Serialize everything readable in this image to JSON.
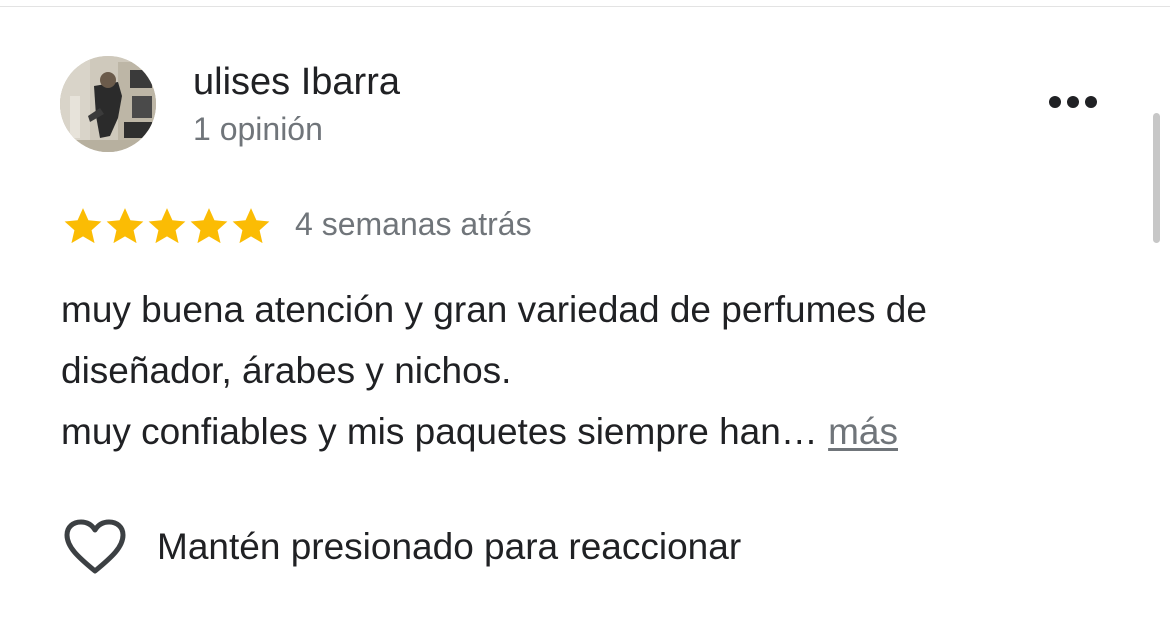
{
  "review": {
    "author": {
      "name": "ulises Ibarra",
      "meta": "1 opinión",
      "avatar_icon": "profile-photo"
    },
    "menu_icon": "more-horizontal-icon",
    "rating": {
      "value": 5,
      "max": 5,
      "star_color": "#FBBC04"
    },
    "time": "4 semanas atrás",
    "text_lines": [
      "muy buena atención y gran variedad de perfumes de",
      "diseñador, árabes y nichos.",
      "muy confiables y mis paquetes siempre han…"
    ],
    "more_label": "más",
    "reaction": {
      "icon": "heart-outline-icon",
      "label": "Mantén presionado para reaccionar"
    }
  },
  "colors": {
    "primary_text": "#202124",
    "secondary_text": "#70757a",
    "star": "#FBBC04",
    "scrollbar": "#c7c7c7"
  }
}
